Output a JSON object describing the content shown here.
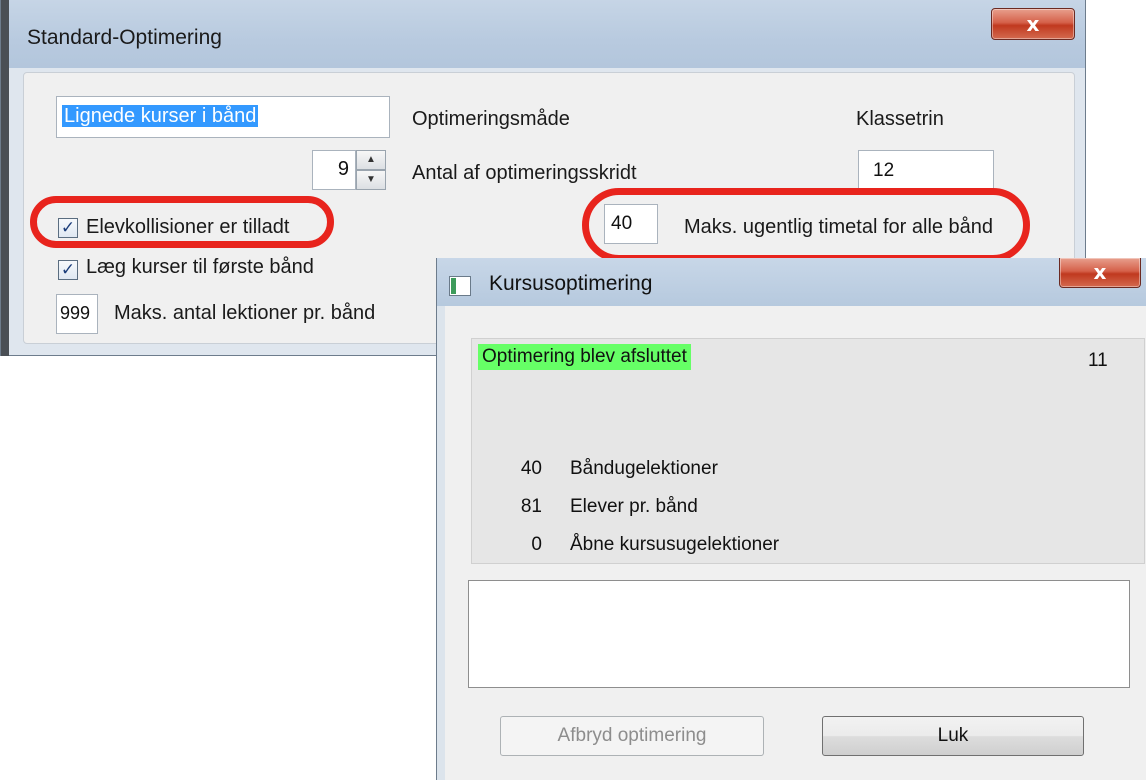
{
  "standard_window": {
    "title": "Standard-Optimering",
    "close_label": "x",
    "name_value": "Lignede kurser i bånd",
    "mode_label": "Optimeringsmåde",
    "grade_label": "Klassetrin",
    "steps_value": "9",
    "steps_label": "Antal af optimeringsskridt",
    "grade_value": "12",
    "collisions_label": "Elevkollisioner er tilladt",
    "collisions_checked": "✓",
    "max_hours_value": "40",
    "max_hours_label": "Maks. ugentlig timetal for alle bånd",
    "first_band_label": "Læg kurser til første bånd",
    "first_band_checked": "✓",
    "max_lessons_value": "999",
    "max_lessons_label": "Maks. antal lektioner pr. bånd"
  },
  "dialog": {
    "title": "Kursusoptimering",
    "close_label": "x",
    "status_text": "Optimering blev afsluttet",
    "status_count": "11",
    "stats": [
      {
        "value": "40",
        "label": "Båndugelektioner"
      },
      {
        "value": "81",
        "label": "Elever pr. bånd"
      },
      {
        "value": "0",
        "label": "Åbne kursusugelektioner"
      }
    ],
    "abort_label": "Afbryd optimering",
    "close_button_label": "Luk"
  },
  "colors": {
    "highlight_oval": "#e8241d",
    "status_badge": "#66ff66",
    "selection": "#3399ff"
  }
}
